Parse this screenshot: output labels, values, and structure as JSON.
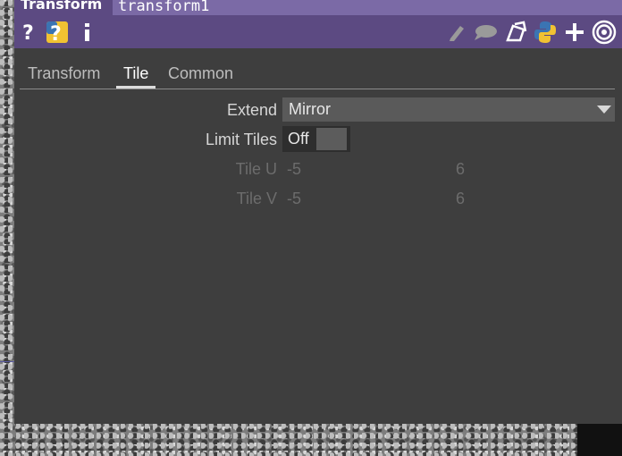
{
  "header": {
    "operator_type": "Transform",
    "operator_name": "transform1",
    "icons": [
      "help-icon",
      "python-help-icon",
      "info-icon",
      "edit-icon",
      "comment-icon",
      "clone-icon",
      "python-icon",
      "add-icon",
      "target-icon"
    ]
  },
  "tabs": [
    {
      "label": "Transform",
      "active": false
    },
    {
      "label": "Tile",
      "active": true
    },
    {
      "label": "Common",
      "active": false
    }
  ],
  "params": {
    "extend": {
      "label": "Extend",
      "value": "Mirror"
    },
    "limit_tiles": {
      "label": "Limit Tiles",
      "value": "Off"
    },
    "tile_u": {
      "label": "Tile U",
      "min": "-5",
      "max": "6"
    },
    "tile_v": {
      "label": "Tile V",
      "min": "-5",
      "max": "6"
    }
  },
  "colors": {
    "header_bg": "#5c4a82",
    "name_field_bg": "#7b6aa6",
    "panel_bg": "#3e3e3e",
    "python_blue": "#3b74b3",
    "python_yellow": "#f1c232"
  }
}
